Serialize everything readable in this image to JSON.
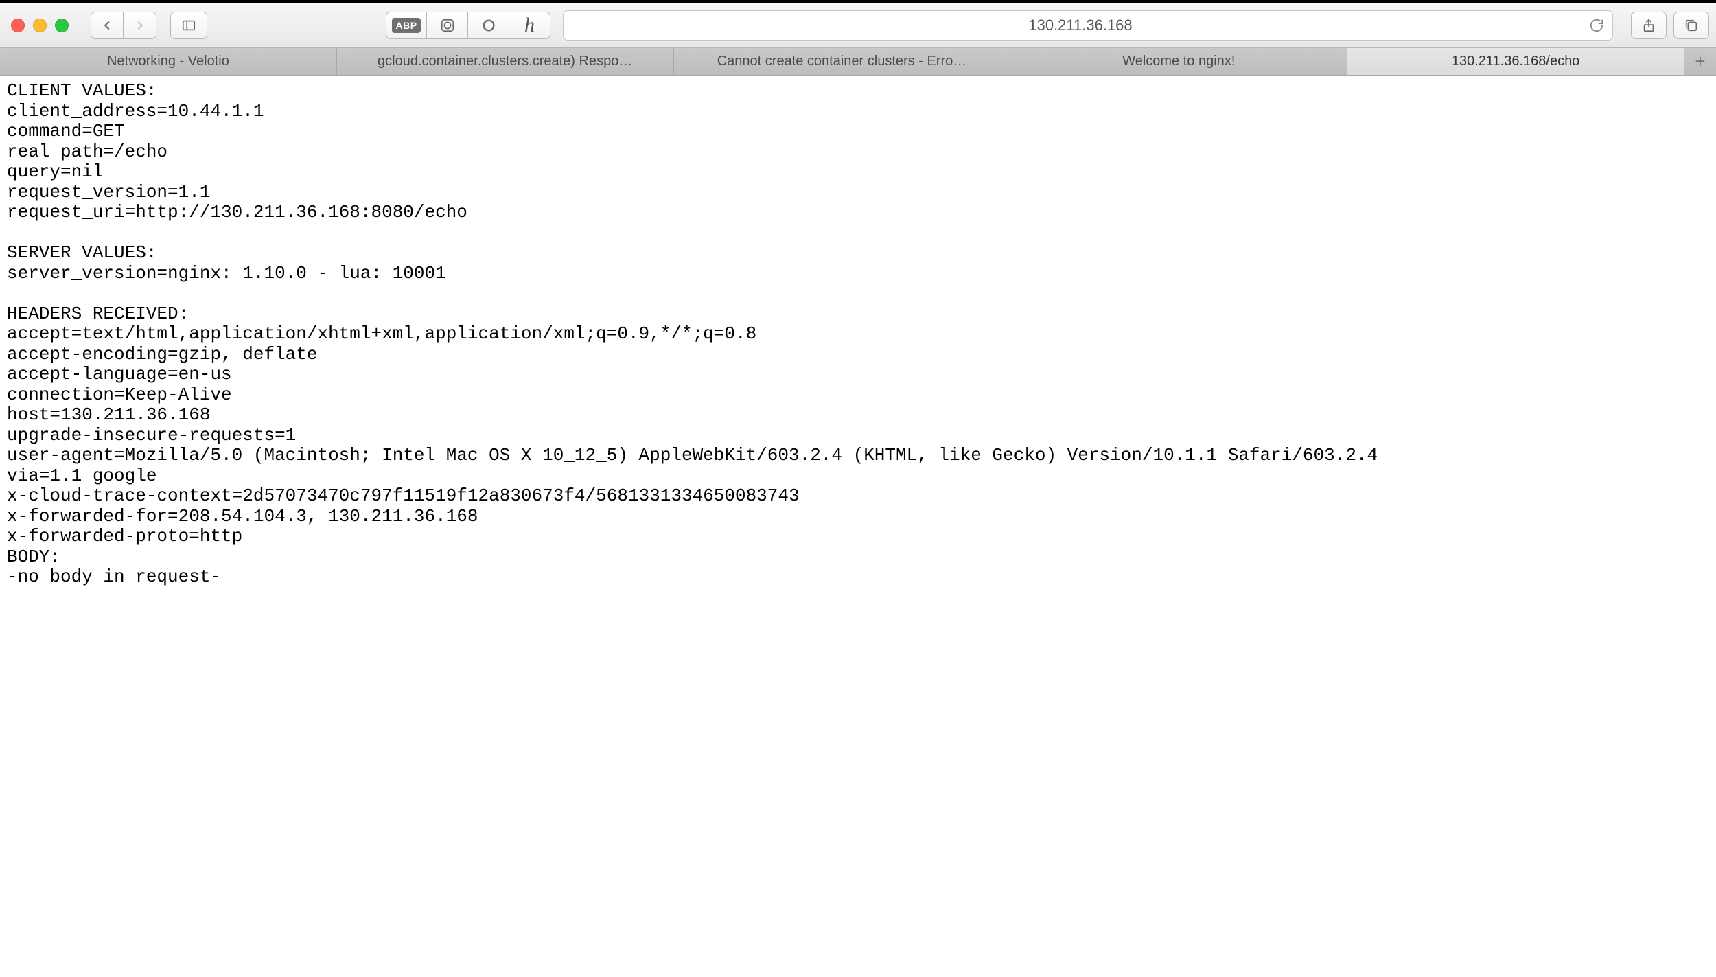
{
  "address_bar": {
    "url": "130.211.36.168"
  },
  "extensions": {
    "abp": "ABP"
  },
  "tabs": [
    {
      "label": "Networking - Velotio",
      "active": false
    },
    {
      "label": "gcloud.container.clusters.create) Respo…",
      "active": false
    },
    {
      "label": "Cannot create container clusters - Erro…",
      "active": false
    },
    {
      "label": "Welcome to nginx!",
      "active": false
    },
    {
      "label": "130.211.36.168/echo",
      "active": true
    }
  ],
  "echo": {
    "client_values_heading": "CLIENT VALUES:",
    "client": {
      "client_address": "client_address=10.44.1.1",
      "command": "command=GET",
      "real_path": "real path=/echo",
      "query": "query=nil",
      "request_version": "request_version=1.1",
      "request_uri": "request_uri=http://130.211.36.168:8080/echo"
    },
    "server_values_heading": "SERVER VALUES:",
    "server": {
      "server_version": "server_version=nginx: 1.10.0 - lua: 10001"
    },
    "headers_heading": "HEADERS RECEIVED:",
    "headers": {
      "accept": "accept=text/html,application/xhtml+xml,application/xml;q=0.9,*/*;q=0.8",
      "accept_encoding": "accept-encoding=gzip, deflate",
      "accept_language": "accept-language=en-us",
      "connection": "connection=Keep-Alive",
      "host": "host=130.211.36.168",
      "upgrade_insecure_requests": "upgrade-insecure-requests=1",
      "user_agent": "user-agent=Mozilla/5.0 (Macintosh; Intel Mac OS X 10_12_5) AppleWebKit/603.2.4 (KHTML, like Gecko) Version/10.1.1 Safari/603.2.4",
      "via": "via=1.1 google",
      "x_cloud_trace_context": "x-cloud-trace-context=2d57073470c797f11519f12a830673f4/5681331334650083743",
      "x_forwarded_for": "x-forwarded-for=208.54.104.3, 130.211.36.168",
      "x_forwarded_proto": "x-forwarded-proto=http"
    },
    "body_heading": "BODY:",
    "body_line": "-no body in request-"
  }
}
